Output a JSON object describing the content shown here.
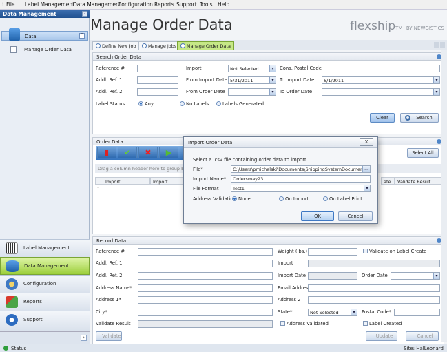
{
  "menu": [
    "File",
    "Label Management",
    "Data Management",
    "Configuration",
    "Reports",
    "Support",
    "Tools",
    "Help"
  ],
  "sidebar": {
    "header": "Data Management",
    "group": "Data",
    "item": "Manage Order Data",
    "nav": [
      "Label Management",
      "Data Management",
      "Configuration",
      "Reports",
      "Support"
    ]
  },
  "page": {
    "title": "Manage Order Data",
    "logo": "flexship",
    "logo_tm": "TM",
    "logo_sub": "BY NEWGISTICS"
  },
  "tabs": [
    "Define New Job",
    "Manage Jobs",
    "Manage Order Data"
  ],
  "search": {
    "title": "Search Order Data",
    "labels": {
      "ref": "Reference #",
      "import": "Import",
      "postal": "Cons. Postal Code",
      "add1": "Addl. Ref. 1",
      "from_import": "From Import Date",
      "to_import": "To Import Date",
      "add2": "Addl. Ref. 2",
      "from_order": "From Order Date",
      "to_order": "To Order Date",
      "status": "Label Status"
    },
    "import_value": "Not Selected",
    "from_import_value": "5/31/2011",
    "to_import_value": "6/1/2011",
    "radios": [
      "Any",
      "No Labels",
      "Labels Generated"
    ],
    "clear": "Clear",
    "search": "Search"
  },
  "order": {
    "title": "Order Data",
    "select_all": "Select All",
    "drag_hint": "Drag a column header here to group by that",
    "cols": [
      "Import",
      "Import...",
      "ate",
      "Validate Result"
    ]
  },
  "dialog": {
    "title": "Import Order Data",
    "close": "X",
    "hint": "Select a .csv file containing order data to import.",
    "file_label": "File*",
    "file_value": "C:\\Users\\pmichalski\\Documents\\ShippingSystemDocumentation\\O...",
    "browse": "...",
    "name_label": "Import Name*",
    "name_value": "Ordersmay23",
    "format_label": "File Format",
    "format_value": "Test1",
    "addr_label": "Address Validation",
    "addr_opts": [
      "None",
      "On Import",
      "On Label Print"
    ],
    "ok": "OK",
    "cancel": "Cancel"
  },
  "record": {
    "title": "Record Data",
    "left": [
      "Reference #",
      "Addl. Ref. 1",
      "Addl. Ref. 2",
      "Address Name*",
      "Address 1*",
      "City*",
      "Validate Result"
    ],
    "mid": [
      "Weight (lbs.)",
      "Import",
      "Import Date",
      "Email Address",
      "Address 2",
      "State*"
    ],
    "validate_label_create": "Validate on Label Create",
    "order_date": "Order Date",
    "state_value": "Not Selected",
    "postal": "Postal Code*",
    "addr_validated": "Address Validated",
    "label_created": "Label Created",
    "validate": "Validate",
    "update": "Update",
    "cancel": "Cancel"
  },
  "status": {
    "left": "Status",
    "right": "Site: HalLeonard"
  }
}
